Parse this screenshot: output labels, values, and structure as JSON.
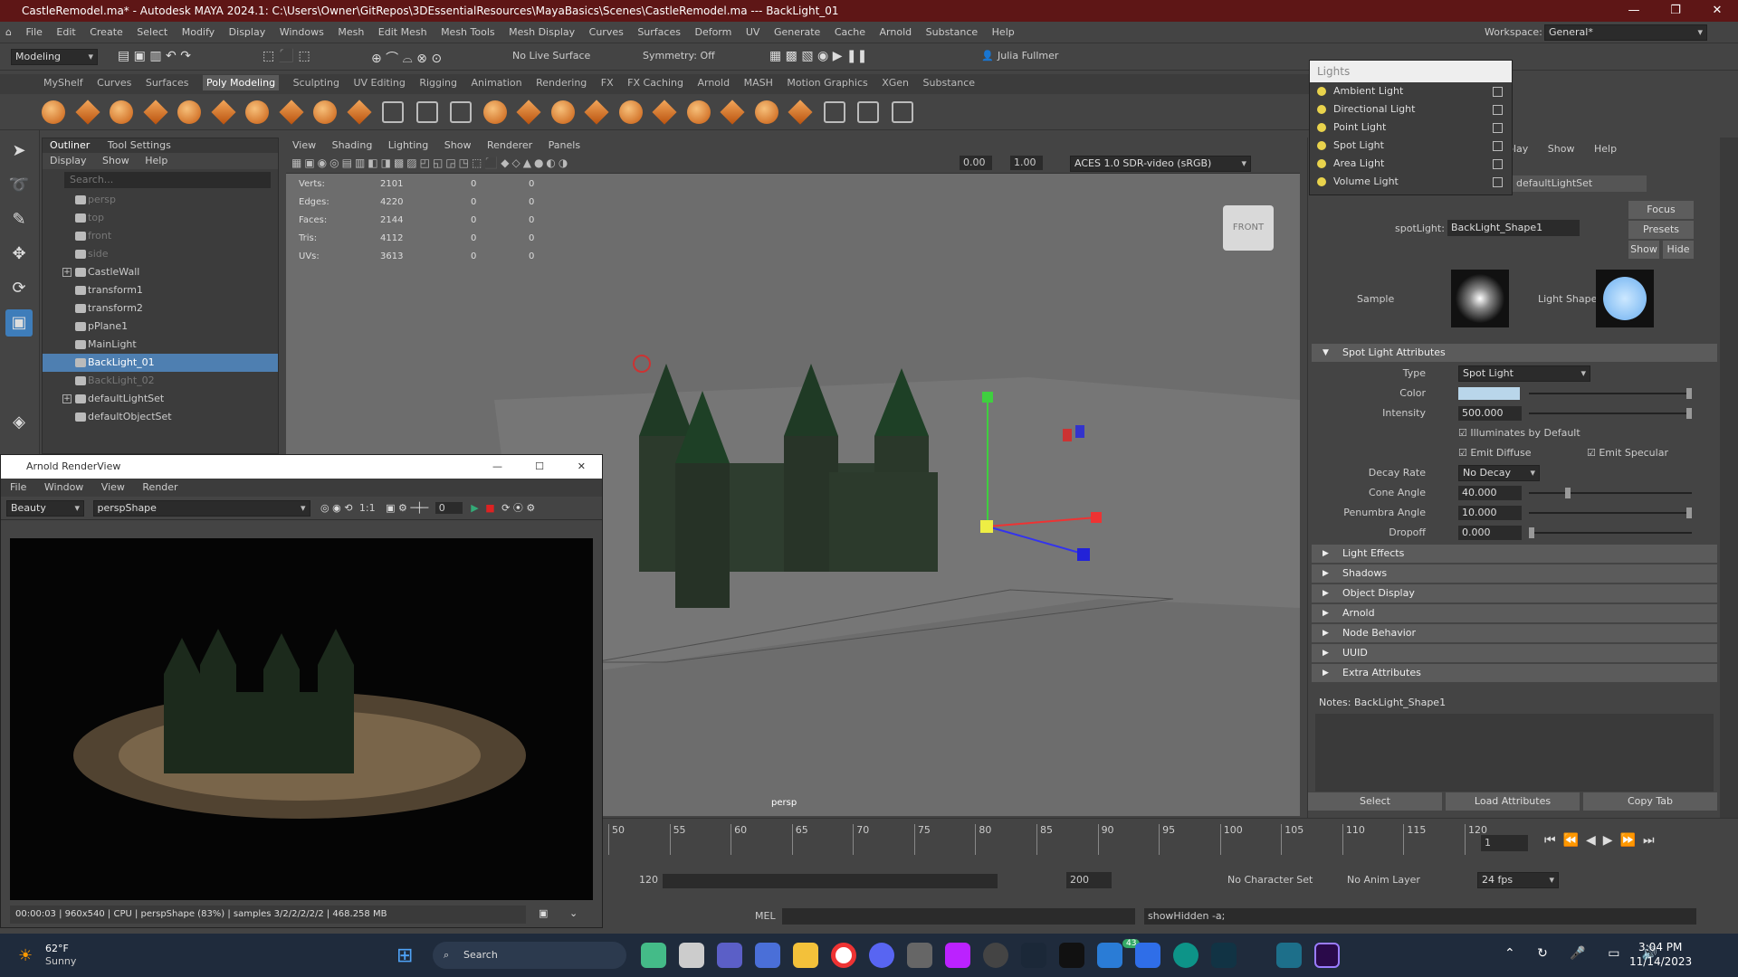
{
  "window": {
    "title": "CastleRemodel.ma* - Autodesk MAYA 2024.1: C:\\Users\\Owner\\GitRepos\\3DEssentialResources\\MayaBasics\\Scenes\\CastleRemodel.ma   ---   BackLight_01"
  },
  "menu": [
    "File",
    "Edit",
    "Create",
    "Select",
    "Modify",
    "Display",
    "Windows",
    "Mesh",
    "Edit Mesh",
    "Mesh Tools",
    "Mesh Display",
    "Curves",
    "Surfaces",
    "Deform",
    "UV",
    "Generate",
    "Cache",
    "Arnold",
    "Substance",
    "Help"
  ],
  "workspace": {
    "label": "Workspace:",
    "value": "General*"
  },
  "status": {
    "menuset": "Modeling",
    "live_surface": "No Live Surface",
    "symmetry": "Symmetry: Off",
    "user": "Julia Fullmer"
  },
  "shelf_tabs": [
    "MyShelf",
    "Curves",
    "Surfaces",
    "Poly Modeling",
    "Sculpting",
    "UV Editing",
    "Rigging",
    "Animation",
    "Rendering",
    "FX",
    "FX Caching",
    "Arnold",
    "MASH",
    "Motion Graphics",
    "XGen",
    "Substance"
  ],
  "shelf_active": "Poly Modeling",
  "outliner": {
    "tabs": [
      "Outliner",
      "Tool Settings"
    ],
    "menu": [
      "Display",
      "Show",
      "Help"
    ],
    "search_placeholder": "Search...",
    "items": [
      {
        "label": "persp",
        "state": "dim"
      },
      {
        "label": "top",
        "state": "dim"
      },
      {
        "label": "front",
        "state": "dim"
      },
      {
        "label": "side",
        "state": "dim"
      },
      {
        "label": "CastleWall",
        "state": "normal",
        "expand": "+"
      },
      {
        "label": "transform1",
        "state": "normal"
      },
      {
        "label": "transform2",
        "state": "normal"
      },
      {
        "label": "pPlane1",
        "state": "normal"
      },
      {
        "label": "MainLight",
        "state": "normal"
      },
      {
        "label": "BackLight_01",
        "state": "sel"
      },
      {
        "label": "BackLight_02",
        "state": "dim"
      },
      {
        "label": "defaultLightSet",
        "state": "normal",
        "expand": "+"
      },
      {
        "label": "defaultObjectSet",
        "state": "normal"
      }
    ]
  },
  "viewport": {
    "menu": [
      "View",
      "Shading",
      "Lighting",
      "Show",
      "Renderer",
      "Panels"
    ],
    "exposure": "0.00",
    "gamma": "1.00",
    "colorspace": "ACES 1.0 SDR-video (sRGB)",
    "hud": [
      {
        "label": "Verts:",
        "v": "2101",
        "a": "0",
        "b": "0"
      },
      {
        "label": "Edges:",
        "v": "4220",
        "a": "0",
        "b": "0"
      },
      {
        "label": "Faces:",
        "v": "2144",
        "a": "0",
        "b": "0"
      },
      {
        "label": "Tris:",
        "v": "4112",
        "a": "0",
        "b": "0"
      },
      {
        "label": "UVs:",
        "v": "3613",
        "a": "0",
        "b": "0"
      }
    ],
    "viewcube": "FRONT",
    "camera": "persp"
  },
  "renderview": {
    "title": "Arnold RenderView",
    "menu": [
      "File",
      "Window",
      "View",
      "Render"
    ],
    "aov": "Beauty",
    "camera": "perspShape",
    "ratio": "1:1",
    "value": "0",
    "status": "00:00:03 | 960x540 | CPU | perspShape (83%) | samples 3/2/2/2/2/2 | 468.258 MB"
  },
  "lights": {
    "title": "Lights",
    "items": [
      "Ambient Light",
      "Directional Light",
      "Point Light",
      "Spot Light",
      "Area Light",
      "Volume Light"
    ]
  },
  "attr": {
    "menu_partial": [
      "play",
      "Show",
      "Help"
    ],
    "tab_partial": "defaultLightSet",
    "node_label": "spotLight:",
    "node_value": "BackLight_Shape1",
    "buttons": [
      "Focus",
      "Presets",
      "Show",
      "Hide"
    ],
    "sample": "Sample",
    "light_shape": "Light Shape",
    "section": "Spot Light Attributes",
    "type_label": "Type",
    "type_value": "Spot Light",
    "color_label": "Color",
    "color": "#b9d6ea",
    "intensity_label": "Intensity",
    "intensity": "500.000",
    "illum": "Illuminates by Default",
    "emit_diffuse": "Emit Diffuse",
    "emit_specular": "Emit Specular",
    "decay_label": "Decay Rate",
    "decay": "No Decay",
    "cone_label": "Cone Angle",
    "cone": "40.000",
    "penumbra_label": "Penumbra Angle",
    "penumbra": "10.000",
    "dropoff_label": "Dropoff",
    "dropoff": "0.000",
    "collapsed": [
      "Light Effects",
      "Shadows",
      "Object Display",
      "Arnold",
      "Node Behavior",
      "UUID",
      "Extra Attributes"
    ],
    "notes": "Notes:  BackLight_Shape1",
    "bottom_buttons": [
      "Select",
      "Load Attributes",
      "Copy Tab"
    ]
  },
  "timeline": {
    "ticks": [
      "50",
      "55",
      "60",
      "65",
      "70",
      "75",
      "80",
      "85",
      "90",
      "95",
      "100",
      "105",
      "110",
      "115",
      "120"
    ],
    "current": "1",
    "range_end": "120",
    "anim_end": "200",
    "char_set": "No Character Set",
    "anim_layer": "No Anim Layer",
    "fps": "24 fps"
  },
  "cmd": {
    "lang": "MEL",
    "result": "showHidden -a;"
  },
  "taskbar": {
    "weather_temp": "62°F",
    "weather_desc": "Sunny",
    "search": "Search",
    "time": "3:04 PM",
    "date": "11/14/2023",
    "badge": "43"
  }
}
